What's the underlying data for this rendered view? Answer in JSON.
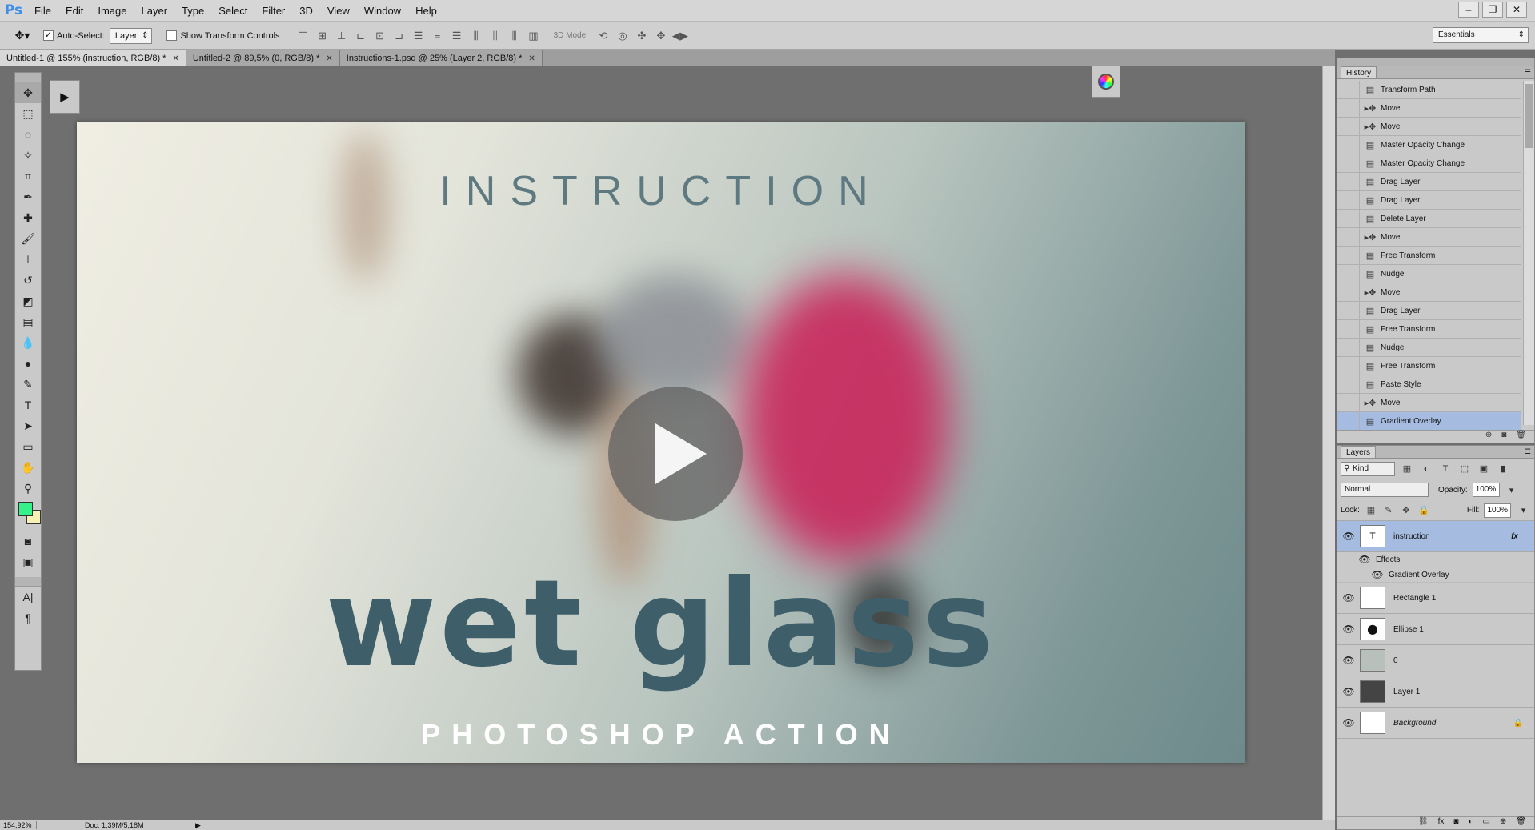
{
  "app": {
    "logo": "Ps"
  },
  "menu": [
    "File",
    "Edit",
    "Image",
    "Layer",
    "Type",
    "Select",
    "Filter",
    "3D",
    "View",
    "Window",
    "Help"
  ],
  "window_controls": [
    "–",
    "❐",
    "✕"
  ],
  "options": {
    "auto_select_label": "Auto-Select:",
    "auto_select_target": "Layer",
    "show_transform_label": "Show Transform Controls",
    "mode3d_label": "3D Mode:",
    "workspace": "Essentials"
  },
  "tabs": [
    {
      "label": "Untitled-1 @ 155% (instruction, RGB/8) *",
      "active": true
    },
    {
      "label": "Untitled-2 @ 89,5% (0, RGB/8) *",
      "active": false
    },
    {
      "label": "Instructions-1.psd @ 25% (Layer 2, RGB/8) *",
      "active": false
    }
  ],
  "canvas": {
    "title_top": "INSTRUCTION",
    "title_main": "wet glass",
    "title_bottom": "PHOTOSHOP ACTION"
  },
  "colors": {
    "foreground": "#36f08a",
    "background": "#f7f1b5",
    "selection": "#a6bbe0"
  },
  "status": {
    "zoom": "154,92%",
    "doc": "Doc: 1,39M/5,18M"
  },
  "history": {
    "title": "History",
    "items": [
      "Transform Path",
      "Move",
      "Move",
      "Master Opacity Change",
      "Master Opacity Change",
      "Drag Layer",
      "Drag Layer",
      "Delete Layer",
      "Move",
      "Free Transform",
      "Nudge",
      "Move",
      "Drag Layer",
      "Free Transform",
      "Nudge",
      "Free Transform",
      "Paste Style",
      "Move",
      "Gradient Overlay"
    ]
  },
  "layers": {
    "title": "Layers",
    "kind": "Kind",
    "blend_mode": "Normal",
    "opacity_label": "Opacity:",
    "opacity": "100%",
    "lock_label": "Lock:",
    "fill_label": "Fill:",
    "fill": "100%",
    "effects_label": "Effects",
    "effect_name": "Gradient Overlay",
    "items": [
      "instruction",
      "Rectangle 1",
      "Ellipse 1",
      "0",
      "Layer 1",
      "Background"
    ]
  }
}
